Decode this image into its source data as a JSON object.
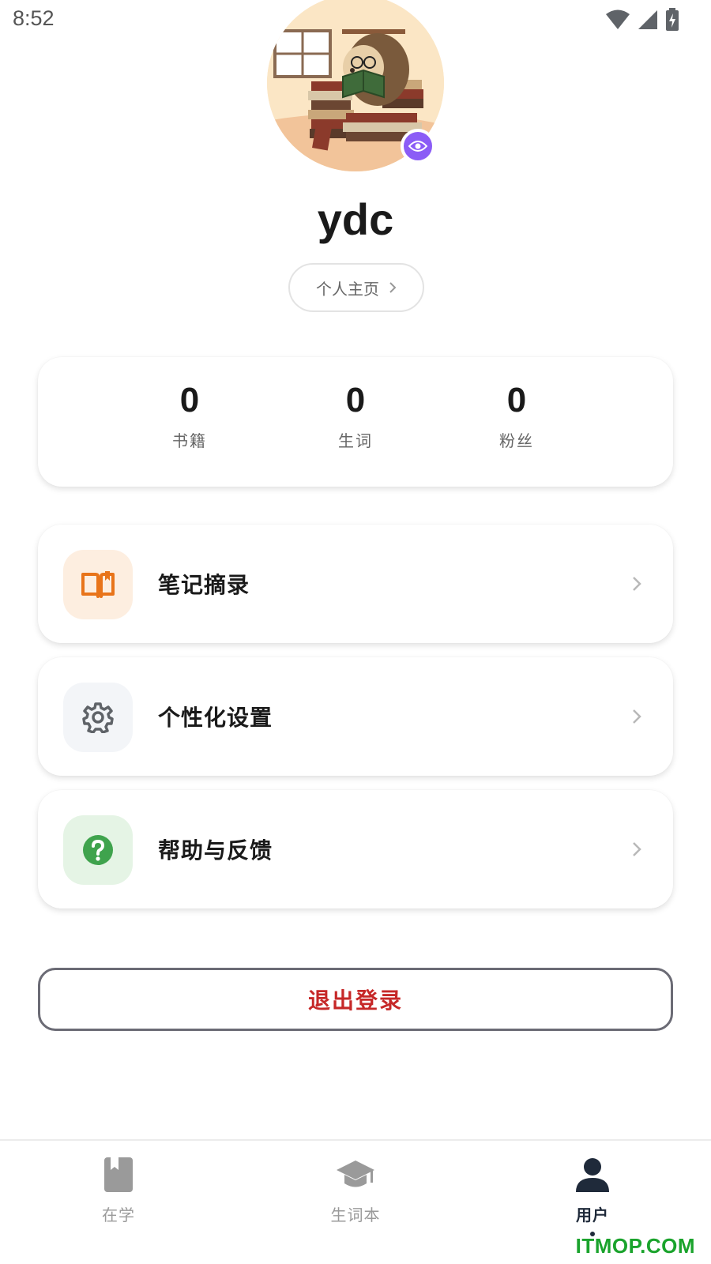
{
  "status_bar": {
    "time": "8:52",
    "icons": [
      "wifi-icon",
      "signal-icon",
      "battery-charging-icon"
    ]
  },
  "profile": {
    "avatar_icon": "hedgehog-reading-avatar",
    "badge_icon": "eye-icon",
    "username": "ydc",
    "home_button_label": "个人主页"
  },
  "stats": [
    {
      "value": "0",
      "label": "书籍"
    },
    {
      "value": "0",
      "label": "生词"
    },
    {
      "value": "0",
      "label": "粉丝"
    }
  ],
  "menu": {
    "notes_label": "笔记摘录",
    "settings_label": "个性化设置",
    "help_label": "帮助与反馈"
  },
  "logout_label": "退出登录",
  "bottom_nav": {
    "study_label": "在学",
    "vocab_label": "生词本",
    "user_label": "用户",
    "active": "user"
  },
  "watermark": "ITMOP.COM",
  "colors": {
    "notes_accent": "#e8741a",
    "notes_bg": "#fdeee0",
    "settings_accent": "#5f6368",
    "settings_bg": "#f3f5f8",
    "help_accent": "#3fa34d",
    "help_bg": "#e5f4e5",
    "logout_text": "#c62828",
    "nav_active": "#1f2a3a",
    "nav_inactive": "#9a9a9a"
  }
}
